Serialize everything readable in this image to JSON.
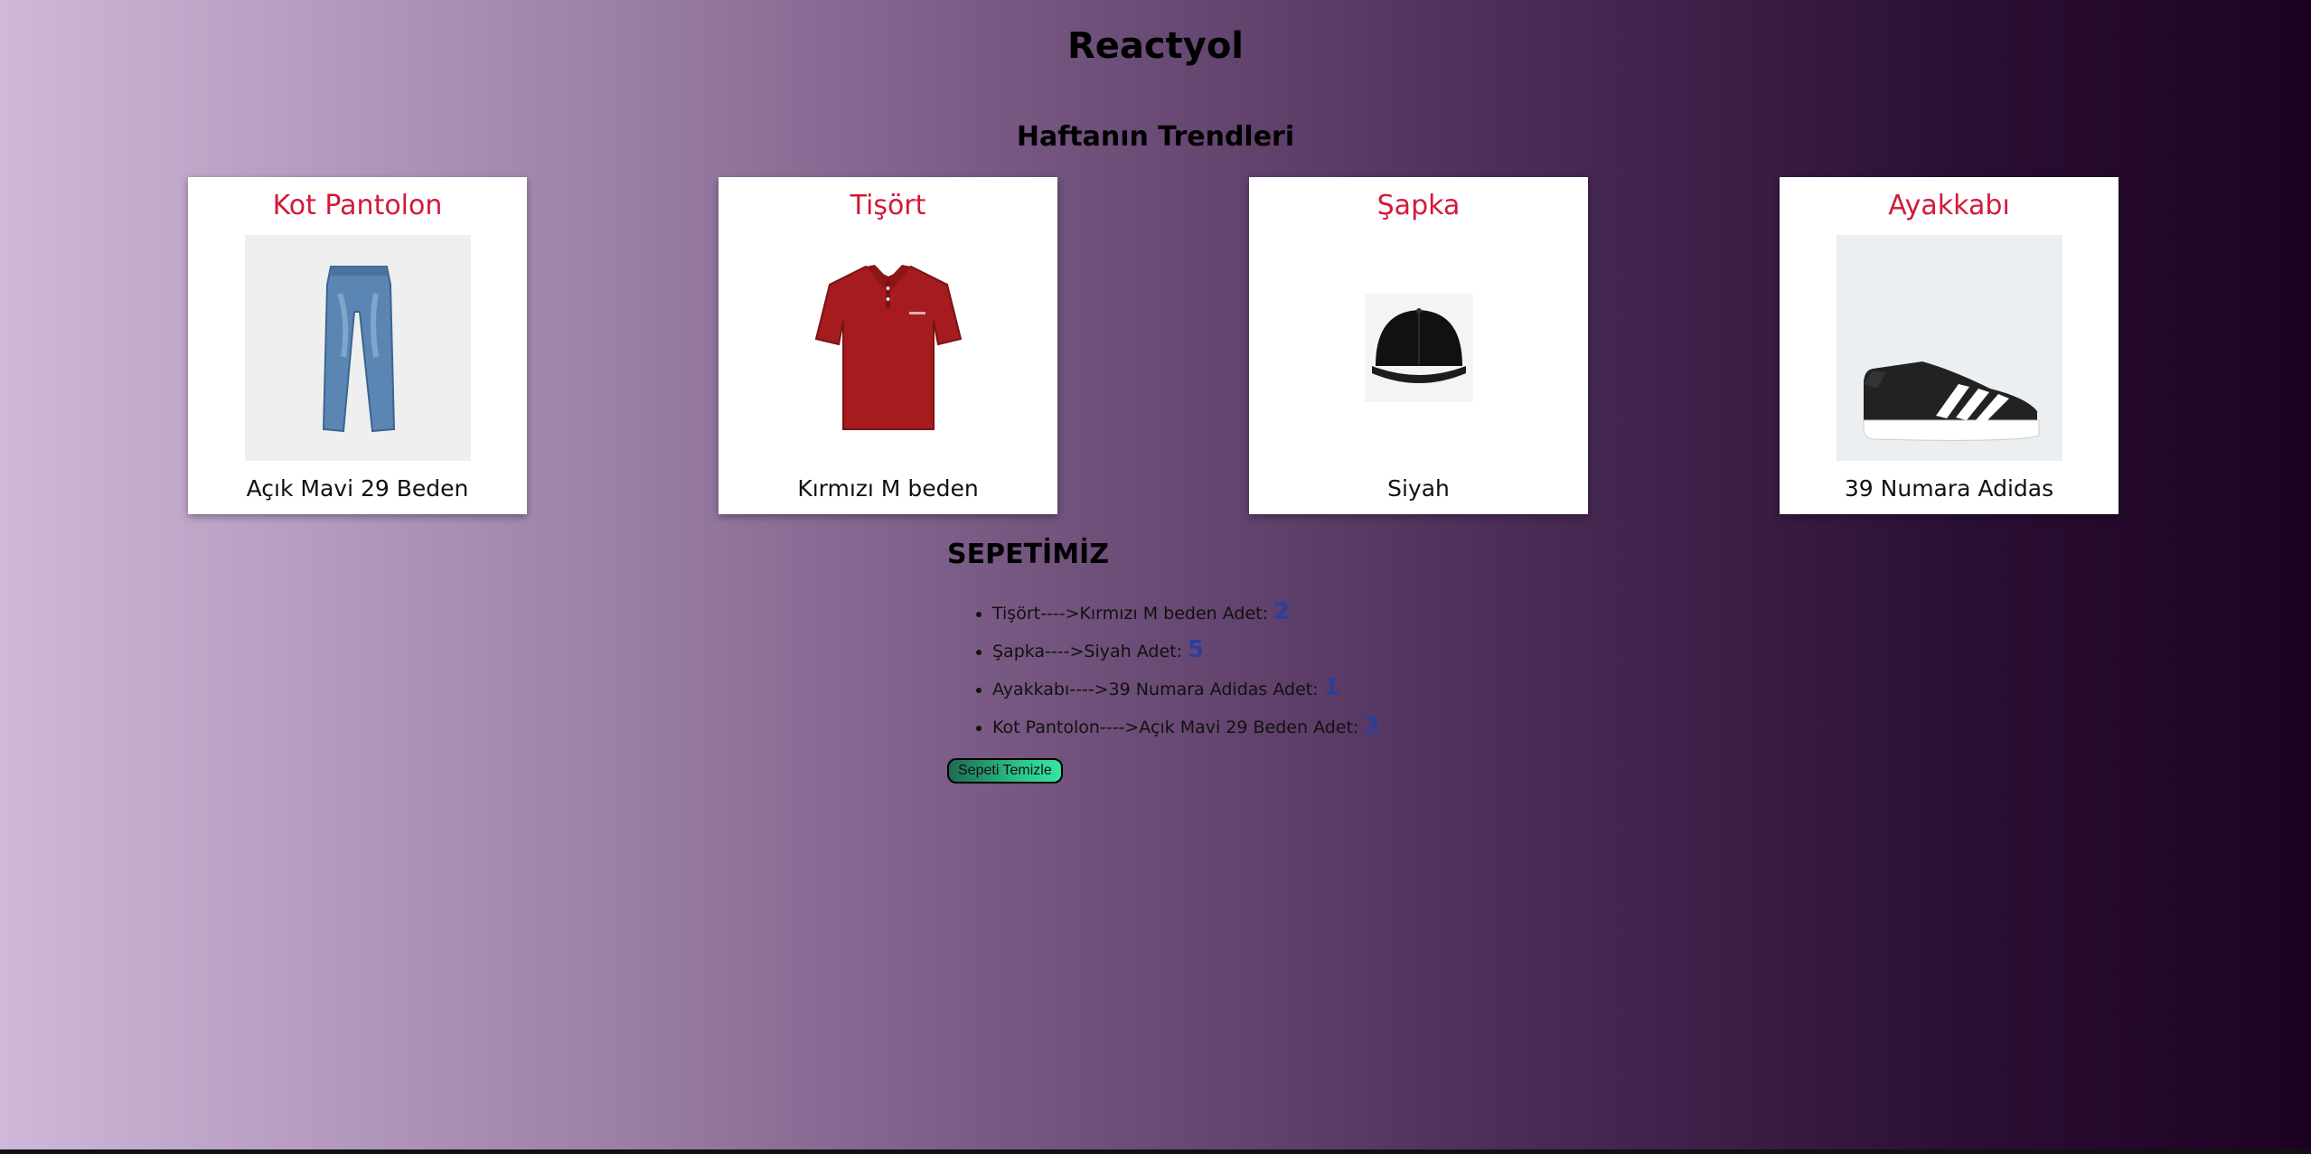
{
  "header": {
    "title": "Reactyol"
  },
  "trends": {
    "title": "Haftanın Trendleri",
    "products": [
      {
        "name": "Kot Pantolon",
        "desc": "Açık Mavi 29 Beden",
        "icon": "jeans-image"
      },
      {
        "name": "Tişört",
        "desc": "Kırmızı M beden",
        "icon": "polo-shirt-image"
      },
      {
        "name": "Şapka",
        "desc": "Siyah",
        "icon": "cap-image"
      },
      {
        "name": "Ayakkabı",
        "desc": "39 Numara Adidas",
        "icon": "sneaker-image"
      }
    ]
  },
  "cart": {
    "title": "SEPETİMİZ",
    "items": [
      {
        "text": "Tişört---->Kırmızı M beden Adet: ",
        "qty": "2"
      },
      {
        "text": "Şapka---->Siyah Adet: ",
        "qty": "5"
      },
      {
        "text": "Ayakkabı---->39 Numara Adidas Adet: ",
        "qty": "1"
      },
      {
        "text": "Kot Pantolon---->Açık Mavi 29 Beden Adet: ",
        "qty": "3"
      }
    ],
    "clear_label": "Sepeti Temizle"
  },
  "colors": {
    "product_title": "#d3193a",
    "qty": "#2a3f9a",
    "button_accent": "#2ccd8d"
  }
}
